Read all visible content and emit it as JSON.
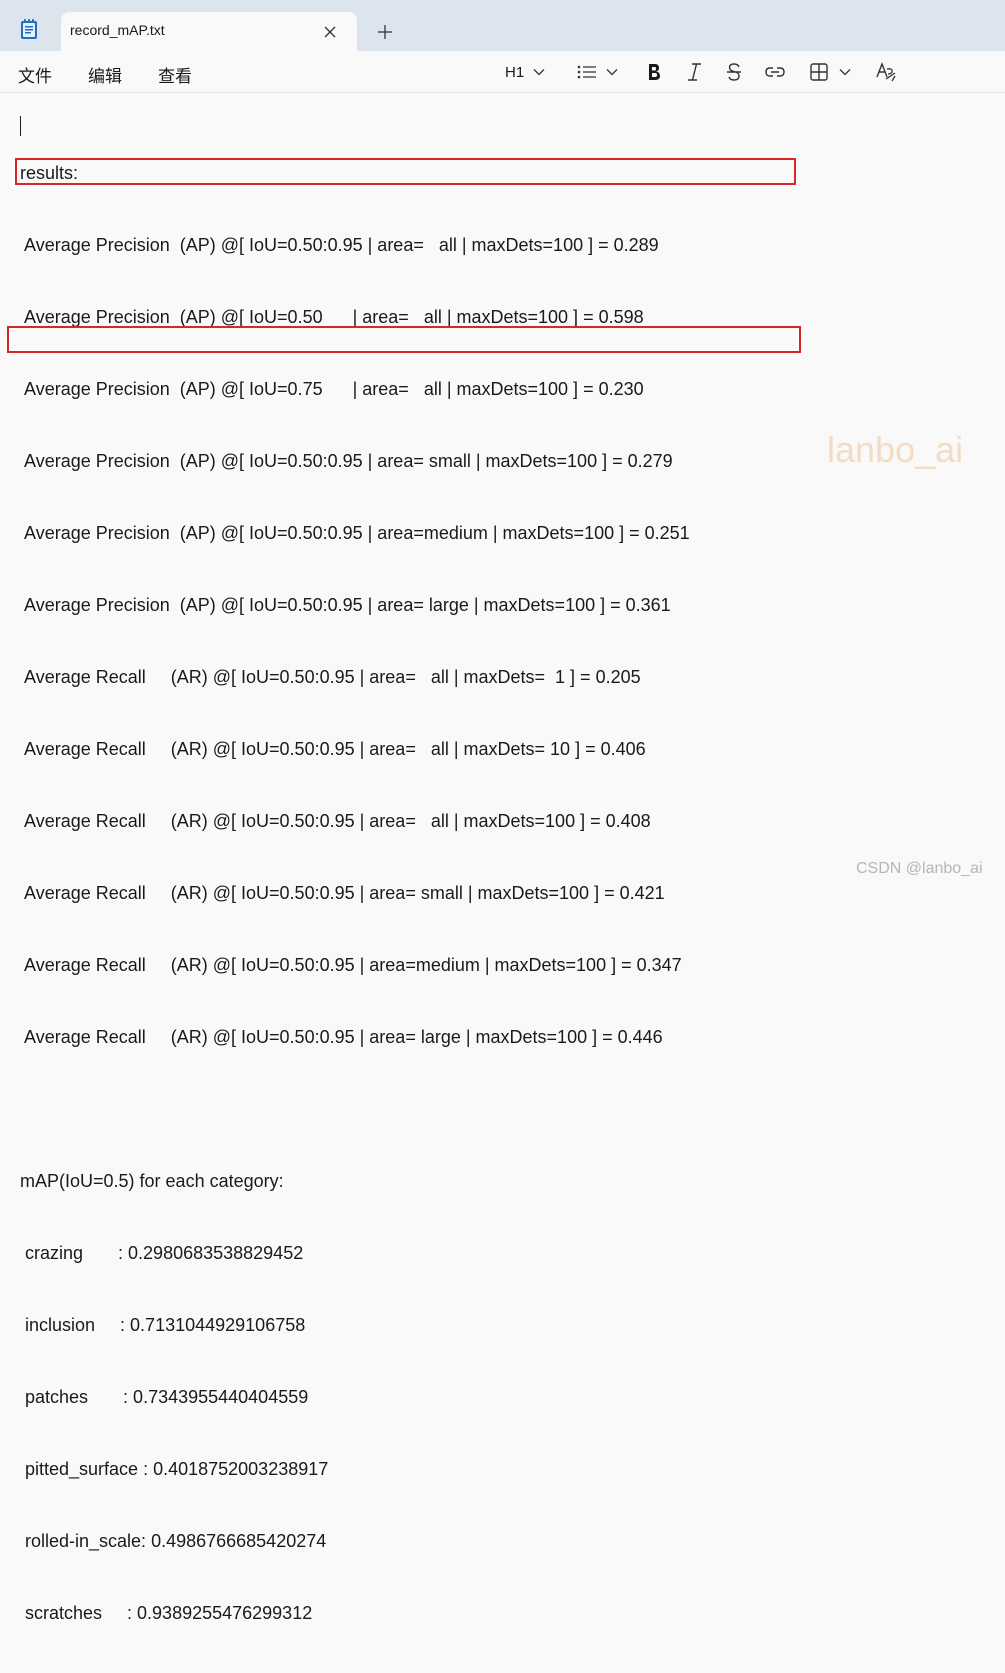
{
  "window": {
    "tab_title": "record_mAP.txt",
    "icons": {
      "app": "notepad-icon",
      "close": "close-icon",
      "new_tab": "plus-icon"
    }
  },
  "menu": {
    "file": "文件",
    "edit": "编辑",
    "view": "查看"
  },
  "toolbar": {
    "heading_label": "H1",
    "icons": [
      "chevron-down-icon",
      "list-icon",
      "bold-icon",
      "italic-icon",
      "strikethrough-icon",
      "link-icon",
      "table-icon",
      "clear-formatting-icon"
    ]
  },
  "document": {
    "lines": [
      "results:",
      " Average Precision  (AP) @[ IoU=0.50:0.95 | area=   all | maxDets=100 ] = 0.289",
      " Average Precision  (AP) @[ IoU=0.50      | area=   all | maxDets=100 ] = 0.598",
      " Average Precision  (AP) @[ IoU=0.75      | area=   all | maxDets=100 ] = 0.230",
      " Average Precision  (AP) @[ IoU=0.50:0.95 | area= small | maxDets=100 ] = 0.279",
      " Average Precision  (AP) @[ IoU=0.50:0.95 | area=medium | maxDets=100 ] = 0.251",
      " Average Precision  (AP) @[ IoU=0.50:0.95 | area= large | maxDets=100 ] = 0.361",
      " Average Recall     (AR) @[ IoU=0.50:0.95 | area=   all | maxDets=  1 ] = 0.205",
      " Average Recall     (AR) @[ IoU=0.50:0.95 | area=   all | maxDets= 10 ] = 0.406",
      " Average Recall     (AR) @[ IoU=0.50:0.95 | area=   all | maxDets=100 ] = 0.408",
      " Average Recall     (AR) @[ IoU=0.50:0.95 | area= small | maxDets=100 ] = 0.421",
      " Average Recall     (AR) @[ IoU=0.50:0.95 | area=medium | maxDets=100 ] = 0.347",
      " Average Recall     (AR) @[ IoU=0.50:0.95 | area= large | maxDets=100 ] = 0.446",
      "",
      "mAP(IoU=0.5) for each category:",
      " crazing       : 0.2980683538829452",
      " inclusion     : 0.7131044929106758",
      " patches       : 0.7343955440404559",
      " pitted_surface : 0.4018752003238917",
      " rolled-in_scale: 0.4986766685420274",
      " scratches     : 0.9389255476299312"
    ]
  },
  "highlight_color": "#d9262b",
  "watermark": "lanbo_ai",
  "credit": "CSDN @lanbo_ai"
}
